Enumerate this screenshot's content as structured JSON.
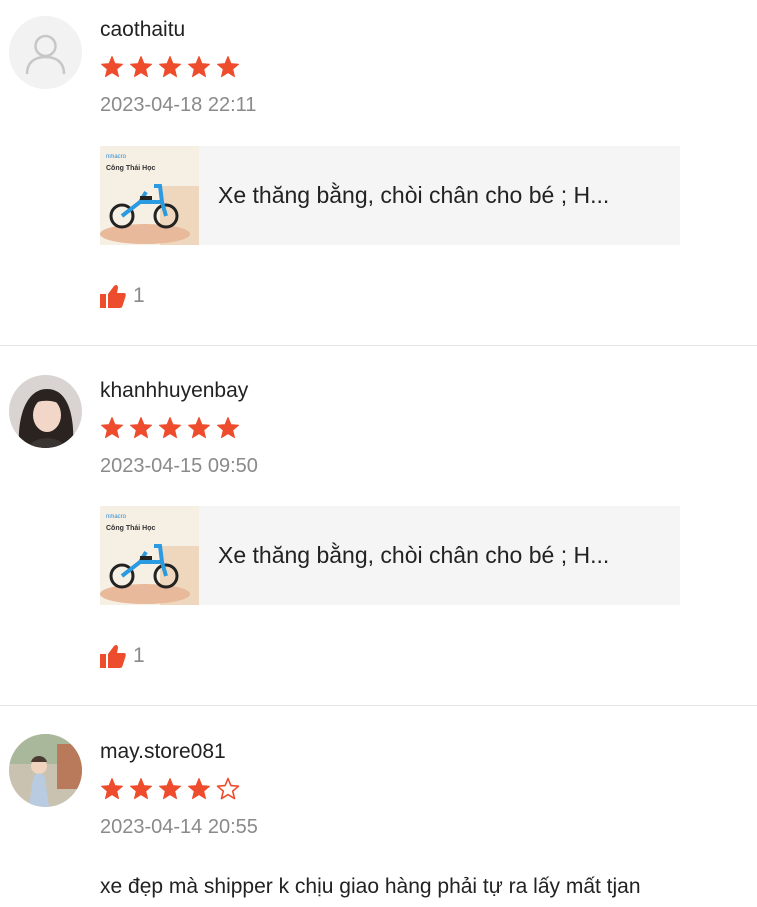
{
  "colors": {
    "accent": "#ee4d2d",
    "muted": "#8a8a8a",
    "divider": "#e6e6e6",
    "card_bg": "#f5f5f5"
  },
  "reviews": [
    {
      "username": "caothaitu",
      "rating": 5,
      "date": "2023-04-18 22:11",
      "product": {
        "name": "Xe thăng bằng, chòi chân cho bé ; H...",
        "thumb_brand": "nmacro",
        "thumb_tagline": "Công Thái Học"
      },
      "likes": "1",
      "avatar": "default-user-icon"
    },
    {
      "username": "khanhhuyenbay",
      "rating": 5,
      "date": "2023-04-15 09:50",
      "product": {
        "name": "Xe thăng bằng, chòi chân cho bé ; H...",
        "thumb_brand": "nmacro",
        "thumb_tagline": "Công Thái Học"
      },
      "likes": "1",
      "avatar": "user-photo"
    },
    {
      "username": "may.store081",
      "rating": 4,
      "date": "2023-04-14 20:55",
      "comment": "xe đẹp mà shipper k chịu giao hàng phải tự ra lấy mất tjan",
      "avatar": "user-photo"
    }
  ]
}
